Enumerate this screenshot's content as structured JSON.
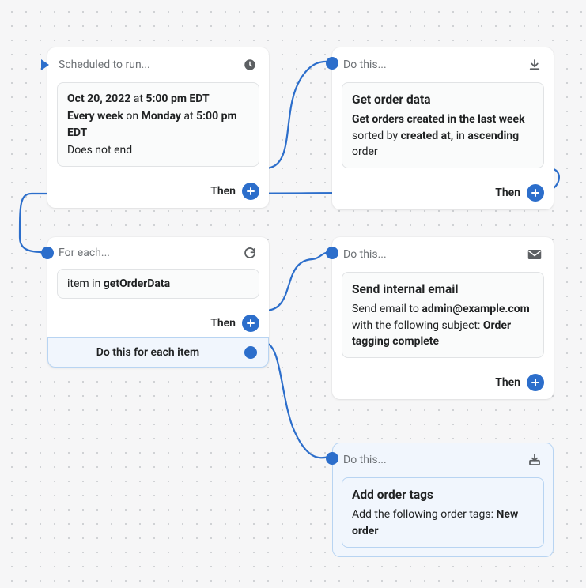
{
  "chart_data": {
    "type": "flow",
    "nodes": [
      {
        "id": "n1",
        "kind": "trigger-schedule",
        "title": "Scheduled to run..."
      },
      {
        "id": "n2",
        "kind": "action-get-order-data",
        "title": "Do this..."
      },
      {
        "id": "n3",
        "kind": "loop-foreach",
        "title": "For each..."
      },
      {
        "id": "n4",
        "kind": "action-send-email",
        "title": "Do this..."
      },
      {
        "id": "n5",
        "kind": "action-add-order-tags",
        "title": "Do this..."
      }
    ],
    "edges": [
      {
        "from": "n1",
        "port": "then",
        "to": "n2"
      },
      {
        "from": "n2",
        "port": "then",
        "to": "n3"
      },
      {
        "from": "n3",
        "port": "then",
        "to": "n4"
      },
      {
        "from": "n3",
        "port": "each",
        "to": "n5"
      }
    ]
  },
  "common": {
    "then_label": "Then"
  },
  "card1": {
    "header": "Scheduled to run...",
    "p1a": "Oct 20, 2022",
    "p1b": " at ",
    "p1c": "5:00 pm EDT",
    "p2a": "Every week",
    "p2b": " on ",
    "p2c": "Monday",
    "p2d": " at ",
    "p2e": "5:00 pm EDT",
    "p3": "Does not end"
  },
  "card2": {
    "header": "Do this...",
    "title": "Get order data",
    "b1a": "Get orders created in the last week",
    "b1b": " sorted by ",
    "b1c": "created at,",
    "b1d": " in ",
    "b1e": "ascending",
    "b1f": " order"
  },
  "card3": {
    "header": "For each...",
    "b1a": "item in ",
    "b1b": "getOrderData",
    "foot": "Do this for each item"
  },
  "card4": {
    "header": "Do this...",
    "title": "Send internal email",
    "b1a": "Send email to ",
    "b1b": "admin@example.com",
    "b1c": " with the following subject: ",
    "b1d": "Order tagging complete"
  },
  "card5": {
    "header": "Do this...",
    "title": "Add order tags",
    "b1a": "Add the following order tags: ",
    "b1b": "New order"
  }
}
